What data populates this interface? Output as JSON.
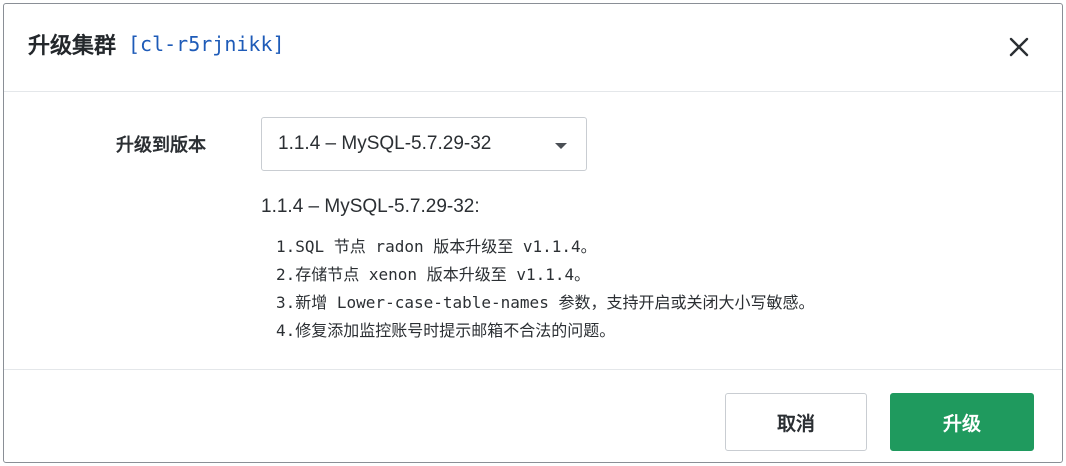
{
  "dialog": {
    "title": "升级集群",
    "cluster_id": "[cl-r5rjnikk]",
    "close_icon": "close-icon"
  },
  "form": {
    "label": "升级到版本",
    "selected_version": "1.1.4 – MySQL-5.7.29-32",
    "caret_icon": "caret-down-icon"
  },
  "description": {
    "title": "1.1.4 – MySQL-5.7.29-32:",
    "notes": [
      "1.SQL 节点 radon 版本升级至 v1.1.4。",
      "2.存储节点 xenon 版本升级至 v1.1.4。",
      "3.新增 Lower-case-table-names 参数，支持开启或关闭大小写敏感。",
      "4.修复添加监控账号时提示邮箱不合法的问题。"
    ]
  },
  "buttons": {
    "cancel": "取消",
    "confirm": "升级"
  },
  "colors": {
    "primary": "#1f9a5e",
    "link": "#1e5bb8",
    "border": "#c9cdd2"
  }
}
